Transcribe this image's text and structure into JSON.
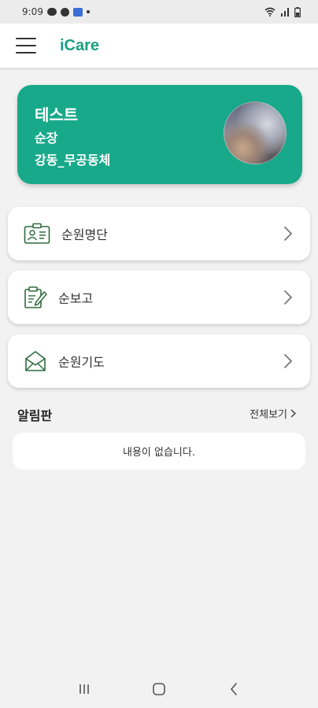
{
  "status_bar": {
    "time": "9:09"
  },
  "app_bar": {
    "title": "iCare"
  },
  "profile": {
    "name": "테스트",
    "rank": "순장",
    "group": "강동_무공동체"
  },
  "menu": [
    {
      "label": "순원명단",
      "icon": "id-card-icon"
    },
    {
      "label": "순보고",
      "icon": "clipboard-edit-icon"
    },
    {
      "label": "순원기도",
      "icon": "envelope-icon"
    }
  ],
  "notice_board": {
    "title": "알림판",
    "see_all_label": "전체보기",
    "empty_message": "내용이 없습니다."
  },
  "colors": {
    "accent": "#18a98a",
    "title": "#1aa083",
    "icon_green": "#2e6b3d"
  }
}
